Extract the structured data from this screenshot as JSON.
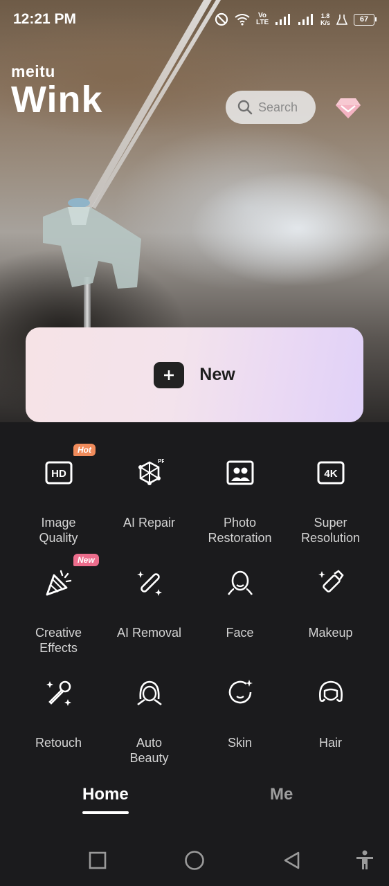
{
  "status_bar": {
    "time": "12:21 PM",
    "network_tag": "Vo LTE",
    "speed_value": "1.8",
    "speed_unit": "K/s",
    "battery": "67"
  },
  "brand": {
    "name_small": "meitu",
    "name_large": "Wink"
  },
  "search": {
    "placeholder": "Search"
  },
  "new_button": {
    "label": "New"
  },
  "tools": [
    {
      "label_line1": "Image",
      "label_line2": "Quality",
      "icon": "hd-icon",
      "badge": "Hot"
    },
    {
      "label_line1": "AI Repair",
      "label_line2": "",
      "icon": "ai-repair-pro-icon",
      "badge": ""
    },
    {
      "label_line1": "Photo",
      "label_line2": "Restoration",
      "icon": "photo-restoration-icon",
      "badge": ""
    },
    {
      "label_line1": "Super",
      "label_line2": "Resolution",
      "icon": "4k-icon",
      "badge": ""
    },
    {
      "label_line1": "Creative",
      "label_line2": "Effects",
      "icon": "party-popper-icon",
      "badge": "New"
    },
    {
      "label_line1": "AI Removal",
      "label_line2": "",
      "icon": "magic-wand-icon",
      "badge": ""
    },
    {
      "label_line1": "Face",
      "label_line2": "",
      "icon": "face-icon",
      "badge": ""
    },
    {
      "label_line1": "Makeup",
      "label_line2": "",
      "icon": "lipstick-icon",
      "badge": ""
    },
    {
      "label_line1": "Retouch",
      "label_line2": "",
      "icon": "retouch-wand-icon",
      "badge": ""
    },
    {
      "label_line1": "Auto",
      "label_line2": "Beauty",
      "icon": "auto-beauty-icon",
      "badge": ""
    },
    {
      "label_line1": "Skin",
      "label_line2": "",
      "icon": "skin-sparkle-icon",
      "badge": ""
    },
    {
      "label_line1": "Hair",
      "label_line2": "",
      "icon": "hair-icon",
      "badge": ""
    }
  ],
  "tabs": {
    "home": "Home",
    "me": "Me"
  },
  "colors": {
    "background": "#1b1b1d",
    "hot_badge": "#f08b5b",
    "new_badge": "#ec6d8c",
    "new_card_start": "#f6e3e6",
    "new_card_end": "#e0d1f8"
  }
}
